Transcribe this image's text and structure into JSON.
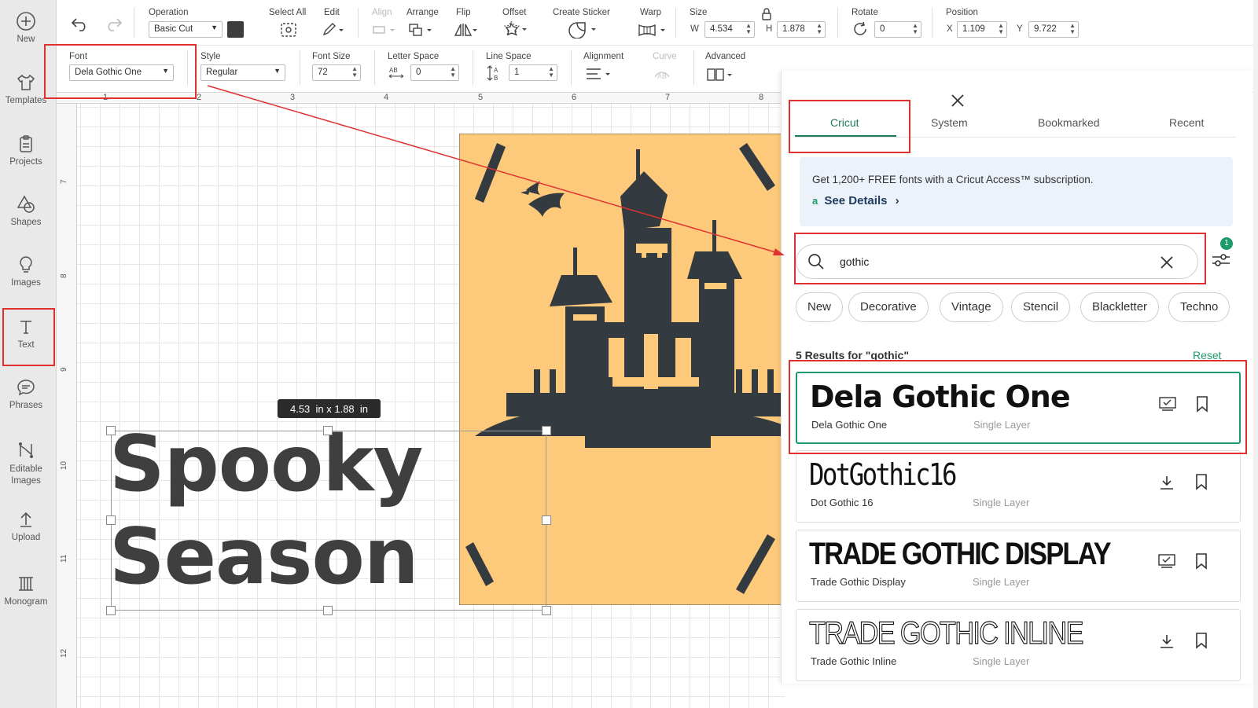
{
  "sidebar": {
    "items": [
      {
        "label": "New",
        "icon": "plus-circle-icon"
      },
      {
        "label": "Templates",
        "icon": "shirt-icon"
      },
      {
        "label": "Projects",
        "icon": "clipboard-icon"
      },
      {
        "label": "Shapes",
        "icon": "shapes-icon"
      },
      {
        "label": "Images",
        "icon": "lightbulb-icon"
      },
      {
        "label": "Text",
        "icon": "text-t-icon"
      },
      {
        "label": "Phrases",
        "icon": "speech-bubble-icon"
      },
      {
        "label": "Editable Images",
        "icon": "edit-nodes-icon"
      },
      {
        "label": "Upload",
        "icon": "upload-icon"
      },
      {
        "label": "Monogram",
        "icon": "monogram-icon"
      }
    ]
  },
  "toolbar1": {
    "operation_label": "Operation",
    "operation_value": "Basic Cut",
    "operation_color": "#3d3d3d",
    "select_all_label": "Select All",
    "edit_label": "Edit",
    "align_label": "Align",
    "arrange_label": "Arrange",
    "flip_label": "Flip",
    "offset_label": "Offset",
    "create_sticker_label": "Create Sticker",
    "warp_label": "Warp",
    "size_label": "Size",
    "w_label": "W",
    "w_value": "4.534",
    "h_label": "H",
    "h_value": "1.878",
    "rotate_label": "Rotate",
    "rotate_value": "0",
    "position_label": "Position",
    "x_label": "X",
    "x_value": "1.109",
    "y_label": "Y",
    "y_value": "9.722"
  },
  "toolbar2": {
    "font_label": "Font",
    "font_value": "Dela Gothic One",
    "style_label": "Style",
    "style_value": "Regular",
    "font_size_label": "Font Size",
    "font_size_value": "72",
    "letter_space_label": "Letter Space",
    "letter_space_value": "0",
    "line_space_label": "Line Space",
    "line_space_value": "1",
    "alignment_label": "Alignment",
    "curve_label": "Curve",
    "advanced_label": "Advanced"
  },
  "ruler": {
    "top": [
      "1",
      "2",
      "3",
      "4",
      "5",
      "6",
      "7",
      "8"
    ],
    "left": [
      "7",
      "8",
      "9",
      "10",
      "11",
      "12"
    ]
  },
  "canvas": {
    "size_tooltip": "4.53  in x 1.88  in",
    "text_line1": "Spooky",
    "text_line2": "Season",
    "card_color": "#fdc97a",
    "ink_color": "#333a40"
  },
  "font_panel": {
    "tabs": [
      "Cricut",
      "System",
      "Bookmarked",
      "Recent"
    ],
    "active_tab": "Cricut",
    "promo_text": "Get 1,200+ FREE fonts with a Cricut Access™ subscription.",
    "promo_link": "See Details",
    "search_value": "gothic",
    "filter_badge": "1",
    "chips": [
      "New",
      "Decorative",
      "Vintage",
      "Stencil",
      "Blackletter",
      "Techno"
    ],
    "results_label": "5 Results for \"gothic\"",
    "reset_label": "Reset",
    "results": [
      {
        "preview": "Dela Gothic One",
        "name": "Dela Gothic One",
        "layer": "Single Layer",
        "status": "installed"
      },
      {
        "preview": "DotGothic16",
        "name": "Dot Gothic 16",
        "layer": "Single Layer",
        "status": "download"
      },
      {
        "preview": "TRADE GOTHIC DISPLAY",
        "name": "Trade Gothic Display",
        "layer": "Single Layer",
        "status": "installed"
      },
      {
        "preview": "TRADE GOTHIC INLINE",
        "name": "Trade Gothic Inline",
        "layer": "Single Layer",
        "status": "download"
      }
    ]
  }
}
